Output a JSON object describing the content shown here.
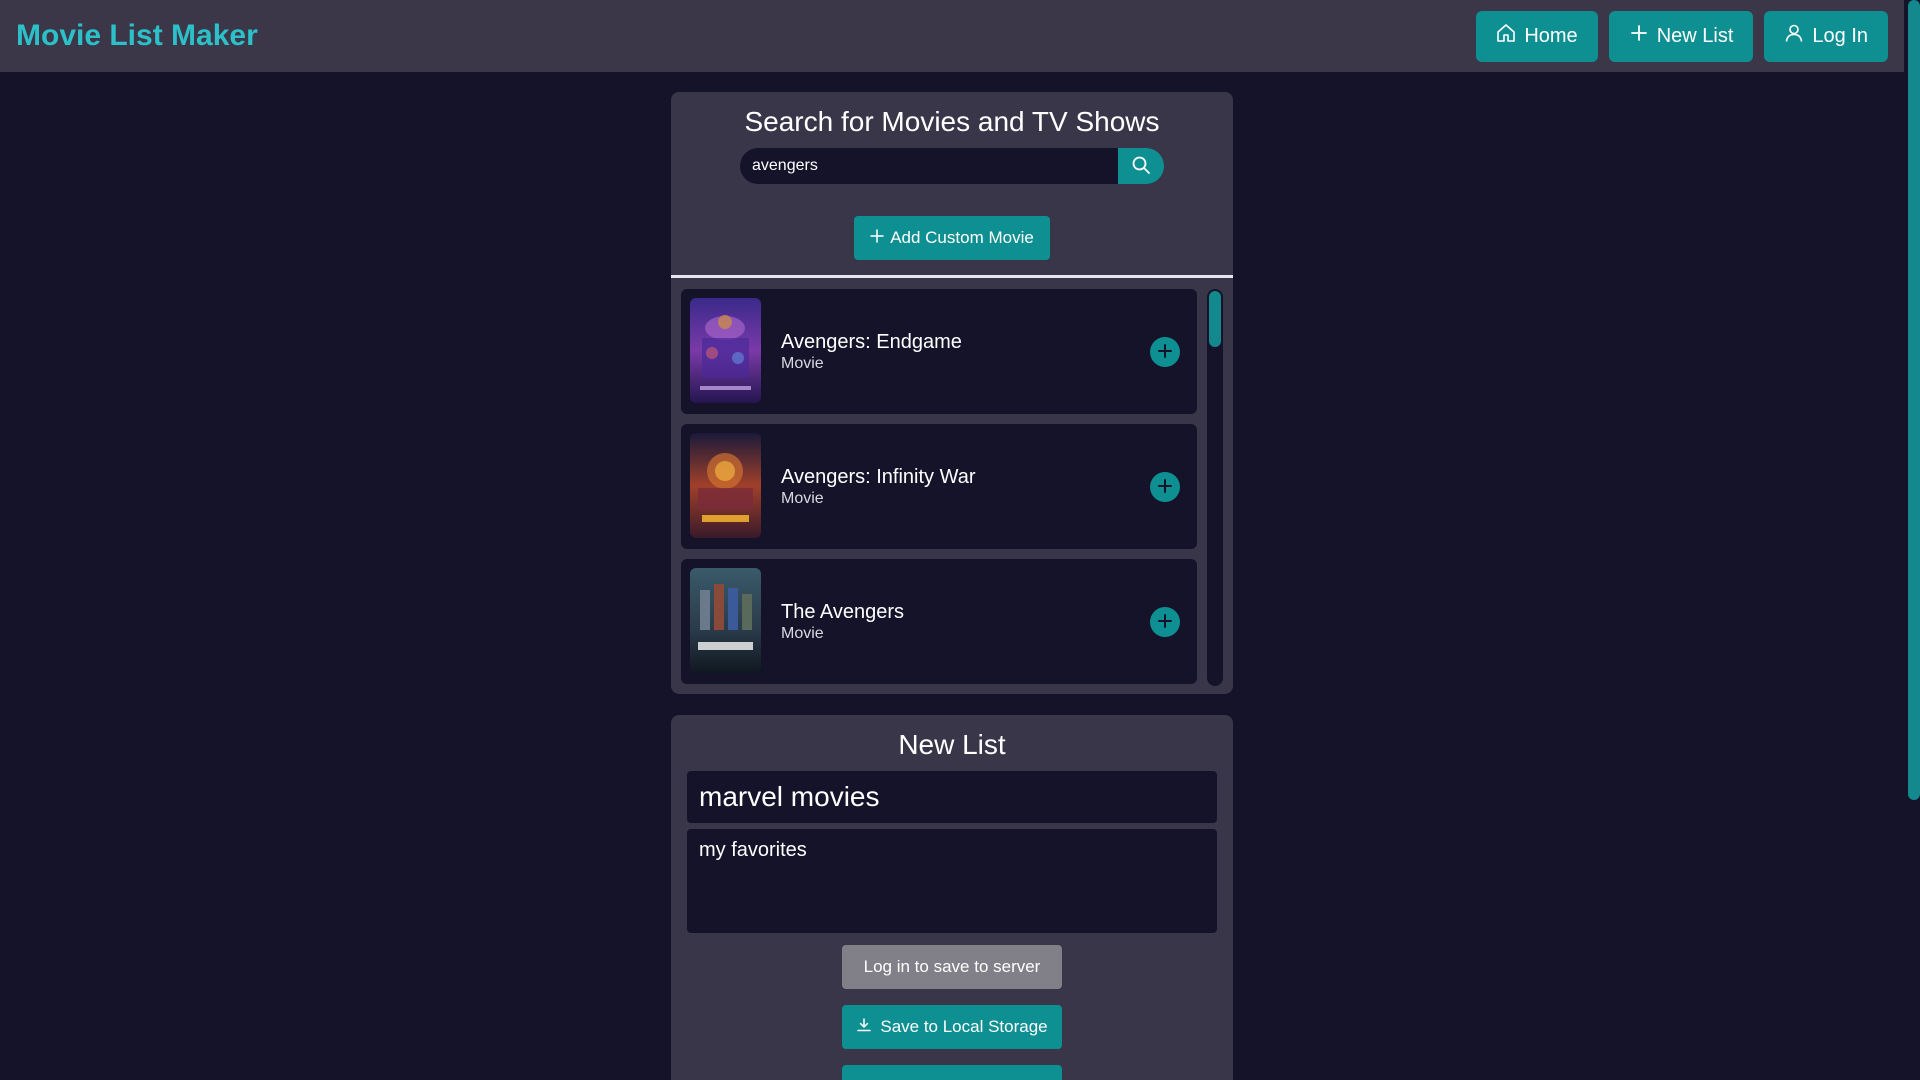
{
  "header": {
    "logo": "Movie List Maker",
    "nav": {
      "home": "Home",
      "new_list": "New List",
      "log_in": "Log In"
    }
  },
  "search": {
    "title": "Search for Movies and TV Shows",
    "query": "avengers",
    "add_custom_label": "Add Custom Movie",
    "results": [
      {
        "title": "Avengers: Endgame",
        "type": "Movie",
        "icon": "poster-endgame"
      },
      {
        "title": "Avengers: Infinity War",
        "type": "Movie",
        "icon": "poster-infinity-war"
      },
      {
        "title": "The Avengers",
        "type": "Movie",
        "icon": "poster-the-avengers"
      }
    ]
  },
  "new_list": {
    "heading": "New List",
    "name_value": "marvel movies",
    "description_value": "my favorites",
    "login_save_label": "Log in to save to server",
    "local_save_label": "Save to Local Storage"
  },
  "colors": {
    "background": "#14132a",
    "panel": "#3a3649",
    "accent": "#0e8f91",
    "logo": "#2cc0c8"
  }
}
